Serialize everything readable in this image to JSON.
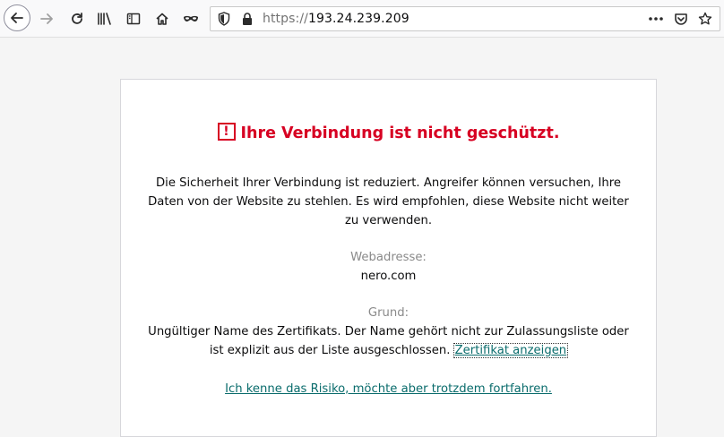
{
  "browser": {
    "url_scheme": "https://",
    "url_host": "193.24.239.209"
  },
  "error": {
    "title": "Ihre Verbindung ist nicht geschützt.",
    "description_lines": [
      "Die Sicherheit Ihrer Verbindung ist reduziert. Angreifer können versuchen, Ihre",
      "Daten von der Website zu stehlen. Es wird empfohlen, diese Website nicht weiter",
      "zu verwenden."
    ],
    "address_label": "Webadresse:",
    "address_value": "nero.com",
    "reason_label": "Grund:",
    "reason_line1": "Ungültiger Name des Zertifikats. Der Name gehört nicht zur Zulassungsliste oder",
    "reason_line2": "ist explizit aus der Liste ausgeschlossen.",
    "cert_link": "Zertifikat anzeigen",
    "proceed_link": "Ich kenne das Risiko, möchte aber trotzdem fortfahren."
  },
  "colors": {
    "error_red": "#d70022",
    "link_teal": "#0a6c6c"
  }
}
